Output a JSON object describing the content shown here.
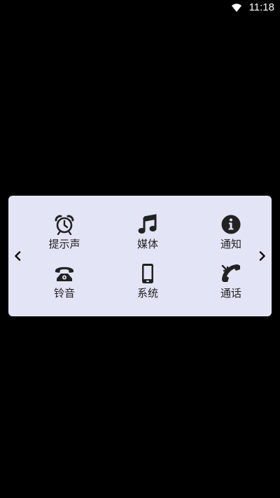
{
  "status_bar": {
    "time": "11:18",
    "icons": [
      "wifi-icon"
    ]
  },
  "sound_panel": {
    "items": [
      {
        "label": "提示声",
        "icon": "alarm-clock-icon"
      },
      {
        "label": "媒体",
        "icon": "music-note-icon"
      },
      {
        "label": "通知",
        "icon": "info-icon"
      },
      {
        "label": "铃音",
        "icon": "telephone-icon"
      },
      {
        "label": "系统",
        "icon": "phone-device-icon"
      },
      {
        "label": "通话",
        "icon": "phone-call-icon"
      }
    ],
    "nav": {
      "prev_icon": "chevron-left-icon",
      "next_icon": "chevron-right-icon"
    }
  },
  "colors": {
    "background": "#000000",
    "panel": "#e3e4f6",
    "icon": "#222222",
    "text": "#222222"
  }
}
